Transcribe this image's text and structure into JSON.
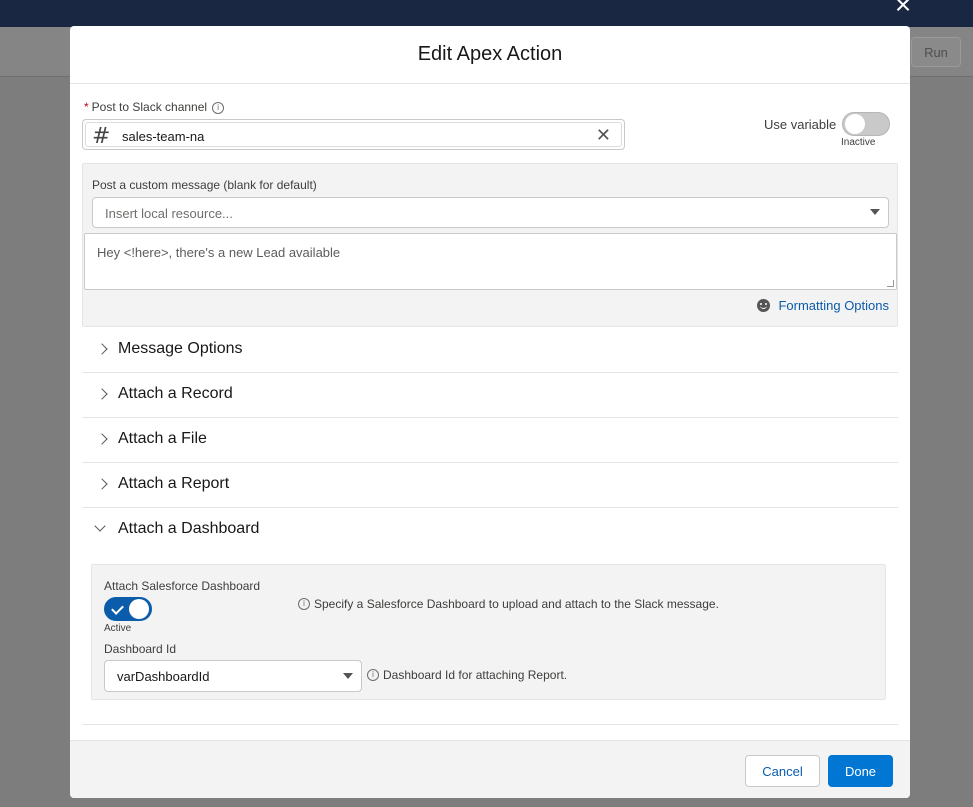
{
  "background": {
    "run_label": "Run",
    "close_icon": "close-icon"
  },
  "modal": {
    "title": "Edit Apex Action"
  },
  "channel": {
    "required_marker": "*",
    "label": "Post to Slack channel",
    "value": "sales-team-na",
    "hash": "#"
  },
  "use_variable": {
    "label": "Use variable",
    "state": "Inactive"
  },
  "message": {
    "label": "Post a custom message (blank for default)",
    "resource_placeholder": "Insert local resource...",
    "text_placeholder": "Hey <!here>, there's a new Lead available",
    "formatting_link": "Formatting Options"
  },
  "sections": [
    {
      "label": "Message Options",
      "expanded": false
    },
    {
      "label": "Attach a Record",
      "expanded": false
    },
    {
      "label": "Attach a File",
      "expanded": false
    },
    {
      "label": "Attach a Report",
      "expanded": false
    },
    {
      "label": "Attach a Dashboard",
      "expanded": true
    }
  ],
  "dashboard": {
    "attach_label": "Attach Salesforce Dashboard",
    "attach_state": "Active",
    "attach_help": "Specify a Salesforce Dashboard to upload and attach to the Slack message.",
    "id_label": "Dashboard Id",
    "id_value": "varDashboardId",
    "id_help": "Dashboard Id for attaching Report."
  },
  "footer": {
    "cancel_label": "Cancel",
    "done_label": "Done"
  },
  "colors": {
    "brand": "#0176d3",
    "link": "#0b5cab",
    "required": "#ba0517",
    "topbar": "#1a2742"
  }
}
